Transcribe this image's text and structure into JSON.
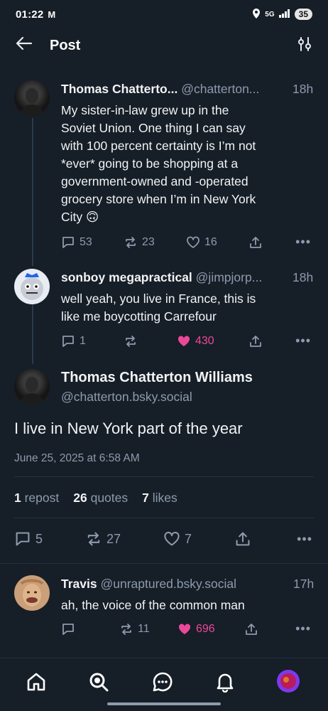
{
  "status_bar": {
    "time": "01:22",
    "battery": "35"
  },
  "header": {
    "title": "Post"
  },
  "parent_post": {
    "name": "Thomas Chatterto...",
    "handle": "@chatterton...",
    "time": "18h",
    "lines": [
      "My sister-in-law grew up in the",
      "Soviet Union. One thing I can say",
      "with 100 percent certainty is I’m not",
      "*ever* going to be shopping at a",
      "government-owned and -operated",
      "grocery store when I’m in New York",
      "City 🙃"
    ],
    "replies": "53",
    "reposts": "23",
    "likes": "16"
  },
  "reply_post": {
    "name": "sonboy megapractical",
    "handle": "@jimpjorp...",
    "time": "18h",
    "lines": [
      "well yeah, you live in France, this is",
      "like me boycotting Carrefour"
    ],
    "replies": "1",
    "likes": "430"
  },
  "main_post": {
    "name": "Thomas Chatterton Williams",
    "handle": "@chatterton.bsky.social",
    "text": "I live in New York part of the year",
    "date": "June 25, 2025 at 6:58 AM",
    "repost_count": "1",
    "repost_label": "repost",
    "quote_count": "26",
    "quote_label": "quotes",
    "like_count": "7",
    "like_label": "likes",
    "replies": "5",
    "reposts": "27",
    "likes": "7"
  },
  "child_reply": {
    "name": "Travis",
    "handle": "@unraptured.bsky.social",
    "time": "17h",
    "text": "ah, the voice of the common man",
    "reposts": "11",
    "likes": "696"
  },
  "colors": {
    "background": "#161e27",
    "like": "#ec4899",
    "muted": "#8d9bae"
  }
}
